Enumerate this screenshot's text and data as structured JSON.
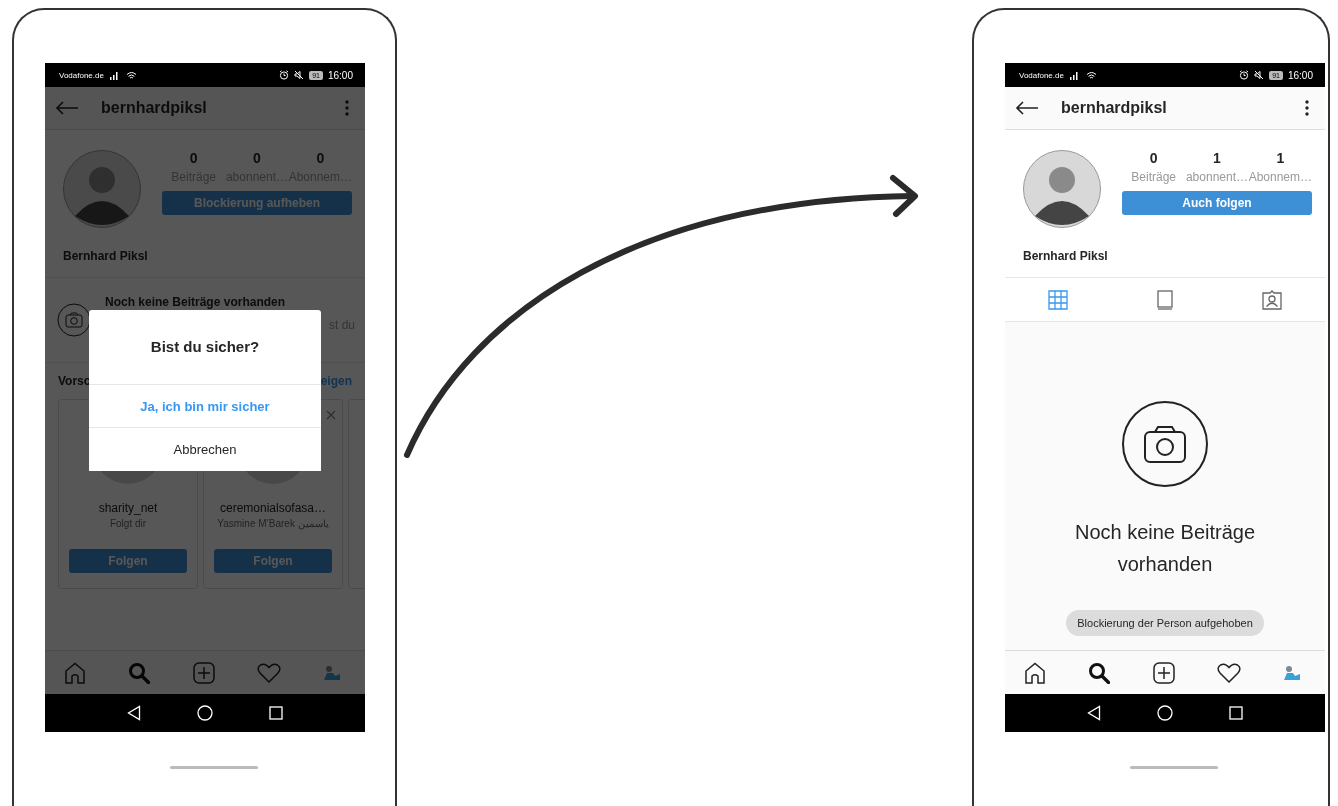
{
  "screens": [
    {
      "dimmed": true,
      "status_bar": {
        "carrier": "Vodafone.de",
        "battery": "91",
        "time": "16:00"
      },
      "app_bar": {
        "title": "bernhardpiksl"
      },
      "profile": {
        "stats": [
          {
            "value": "0",
            "label": "Beiträge"
          },
          {
            "value": "0",
            "label": "abonnent…"
          },
          {
            "value": "0",
            "label": "Abonnem…"
          }
        ],
        "button": "Blockierung aufheben",
        "name": "Bernhard Piksl"
      },
      "empty_notice": {
        "title": "Noch keine Beiträge vorhanden",
        "text": "st du"
      },
      "suggestions": {
        "heading": "Vorsc",
        "link": "eigen",
        "cards": [
          {
            "username": "sharity_net",
            "subtitle": "Folgt dir",
            "button": "Folgen"
          },
          {
            "username": "ceremonialsofasa…",
            "subtitle": "Yasmine M’Barek ياسمين",
            "button": "Folgen"
          }
        ]
      },
      "dialog": {
        "title": "Bist du sicher?",
        "confirm": "Ja, ich bin mir sicher",
        "cancel": "Abbrechen"
      }
    },
    {
      "dimmed": false,
      "status_bar": {
        "carrier": "Vodafone.de",
        "battery": "91",
        "time": "16:00"
      },
      "app_bar": {
        "title": "bernhardpiksl"
      },
      "profile": {
        "stats": [
          {
            "value": "0",
            "label": "Beiträge"
          },
          {
            "value": "1",
            "label": "abonnent…"
          },
          {
            "value": "1",
            "label": "Abonnem…"
          }
        ],
        "button": "Auch folgen",
        "name": "Bernhard Piksl"
      },
      "tabs": [
        {
          "kind": "grid",
          "selected": true
        },
        {
          "kind": "feed",
          "selected": false
        },
        {
          "kind": "tagged",
          "selected": false
        }
      ],
      "empty_state": {
        "text": "Noch keine Beiträge vorhanden"
      },
      "toast": "Blockierung der Person aufgehoben"
    }
  ]
}
